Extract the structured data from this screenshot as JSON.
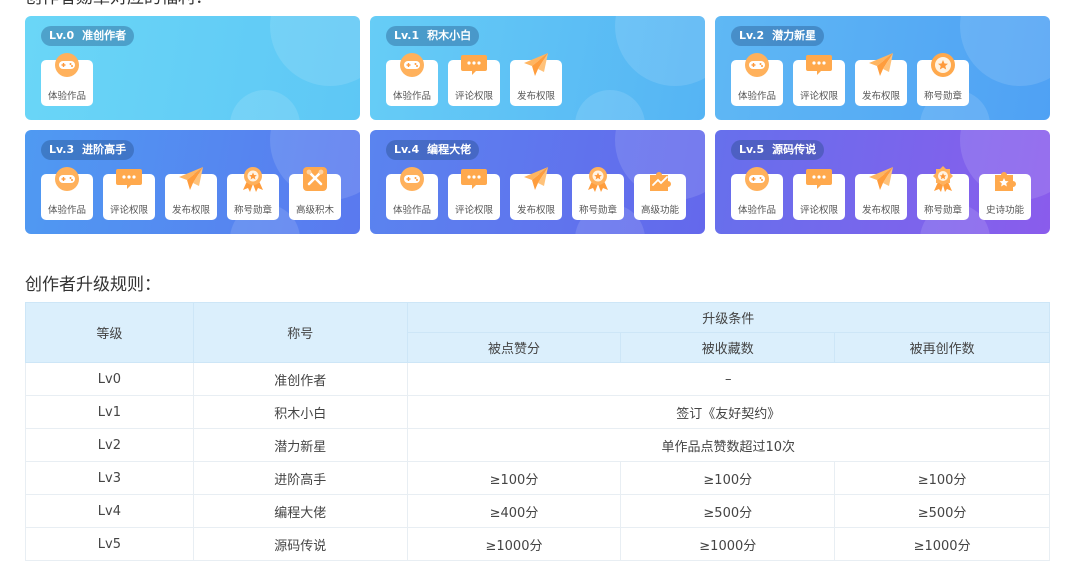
{
  "page_title": "创作者勋章对应的福利：",
  "cards": [
    {
      "level_code": "Lv.0",
      "level_name": "准创作者",
      "bg": [
        "#6ad6f7",
        "#5ec7f5"
      ],
      "items": [
        {
          "label": "体验作品",
          "icon": "gamepad-icon"
        }
      ]
    },
    {
      "level_code": "Lv.1",
      "level_name": "积木小白",
      "bg": [
        "#66cdf6",
        "#55b4f4"
      ],
      "items": [
        {
          "label": "体验作品",
          "icon": "gamepad-icon"
        },
        {
          "label": "评论权限",
          "icon": "comment-icon"
        },
        {
          "label": "发布权限",
          "icon": "paper-plane-icon"
        }
      ]
    },
    {
      "level_code": "Lv.2",
      "level_name": "潜力新星",
      "bg": [
        "#5fb8f4",
        "#4fa1f4"
      ],
      "items": [
        {
          "label": "体验作品",
          "icon": "gamepad-icon"
        },
        {
          "label": "评论权限",
          "icon": "comment-icon"
        },
        {
          "label": "发布权限",
          "icon": "paper-plane-icon"
        },
        {
          "label": "称号勋章",
          "icon": "medal-icon"
        }
      ]
    },
    {
      "level_code": "Lv.3",
      "level_name": "进阶高手",
      "bg": [
        "#4f9af2",
        "#5a79ef"
      ],
      "items": [
        {
          "label": "体验作品",
          "icon": "gamepad-icon"
        },
        {
          "label": "评论权限",
          "icon": "comment-icon"
        },
        {
          "label": "发布权限",
          "icon": "paper-plane-icon"
        },
        {
          "label": "称号勋章",
          "icon": "ribbon-medal-icon"
        },
        {
          "label": "高级积木",
          "icon": "tools-icon"
        }
      ]
    },
    {
      "level_code": "Lv.4",
      "level_name": "编程大佬",
      "bg": [
        "#5a84ef",
        "#6468ec"
      ],
      "items": [
        {
          "label": "体验作品",
          "icon": "gamepad-icon"
        },
        {
          "label": "评论权限",
          "icon": "comment-icon"
        },
        {
          "label": "发布权限",
          "icon": "paper-plane-icon"
        },
        {
          "label": "称号勋章",
          "icon": "ribbon-medal-icon"
        },
        {
          "label": "高级功能",
          "icon": "puzzle-icon"
        }
      ]
    },
    {
      "level_code": "Lv.5",
      "level_name": "源码传说",
      "bg": [
        "#6670ec",
        "#8a5cec"
      ],
      "items": [
        {
          "label": "体验作品",
          "icon": "gamepad-icon"
        },
        {
          "label": "评论权限",
          "icon": "comment-icon"
        },
        {
          "label": "发布权限",
          "icon": "paper-plane-icon"
        },
        {
          "label": "称号勋章",
          "icon": "star-medal-icon"
        },
        {
          "label": "史诗功能",
          "icon": "puzzle-star-icon"
        }
      ]
    }
  ],
  "rules_title": "创作者升级规则：",
  "table": {
    "headers": {
      "level": "等级",
      "title": "称号",
      "conditions": "升级条件",
      "likes": "被点赞分",
      "favorites": "被收藏数",
      "remixes": "被再创作数"
    },
    "rows": [
      {
        "level": "Lv0",
        "title": "准创作者",
        "merged": "–"
      },
      {
        "level": "Lv1",
        "title": "积木小白",
        "merged": "签订《友好契约》"
      },
      {
        "level": "Lv2",
        "title": "潜力新星",
        "merged": "单作品点赞数超过10次"
      },
      {
        "level": "Lv3",
        "title": "进阶高手",
        "likes": "≥100分",
        "favorites": "≥100分",
        "remixes": "≥100分"
      },
      {
        "level": "Lv4",
        "title": "编程大佬",
        "likes": "≥400分",
        "favorites": "≥500分",
        "remixes": "≥500分"
      },
      {
        "level": "Lv5",
        "title": "源码传说",
        "likes": "≥1000分",
        "favorites": "≥1000分",
        "remixes": "≥1000分"
      }
    ]
  }
}
